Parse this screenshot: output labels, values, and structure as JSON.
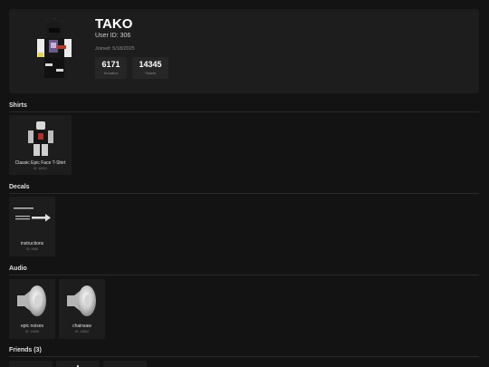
{
  "profile": {
    "username": "TAKO",
    "user_id": "User ID: 306",
    "joined": "Joined: 5/18/2025",
    "stats": [
      {
        "value": "6171",
        "label": "Novabux"
      },
      {
        "value": "14345",
        "label": "Tickets"
      }
    ]
  },
  "sections": {
    "shirts": "Shirts",
    "decals": "Decals",
    "audio": "Audio",
    "friends": "Friends (3)"
  },
  "shirts": [
    {
      "name": "Classic Epic Face T-Shirt",
      "id": "ID: 16091"
    }
  ],
  "decals": [
    {
      "name": "instructions",
      "id": "ID: 9986"
    }
  ],
  "audio": [
    {
      "name": "epic noises",
      "id": "ID: 13685"
    },
    {
      "name": "chainsaw",
      "id": "ID: 13682"
    }
  ],
  "colors": {
    "background": "#131313",
    "card": "#1d1d1d",
    "stat_box": "#262626"
  }
}
